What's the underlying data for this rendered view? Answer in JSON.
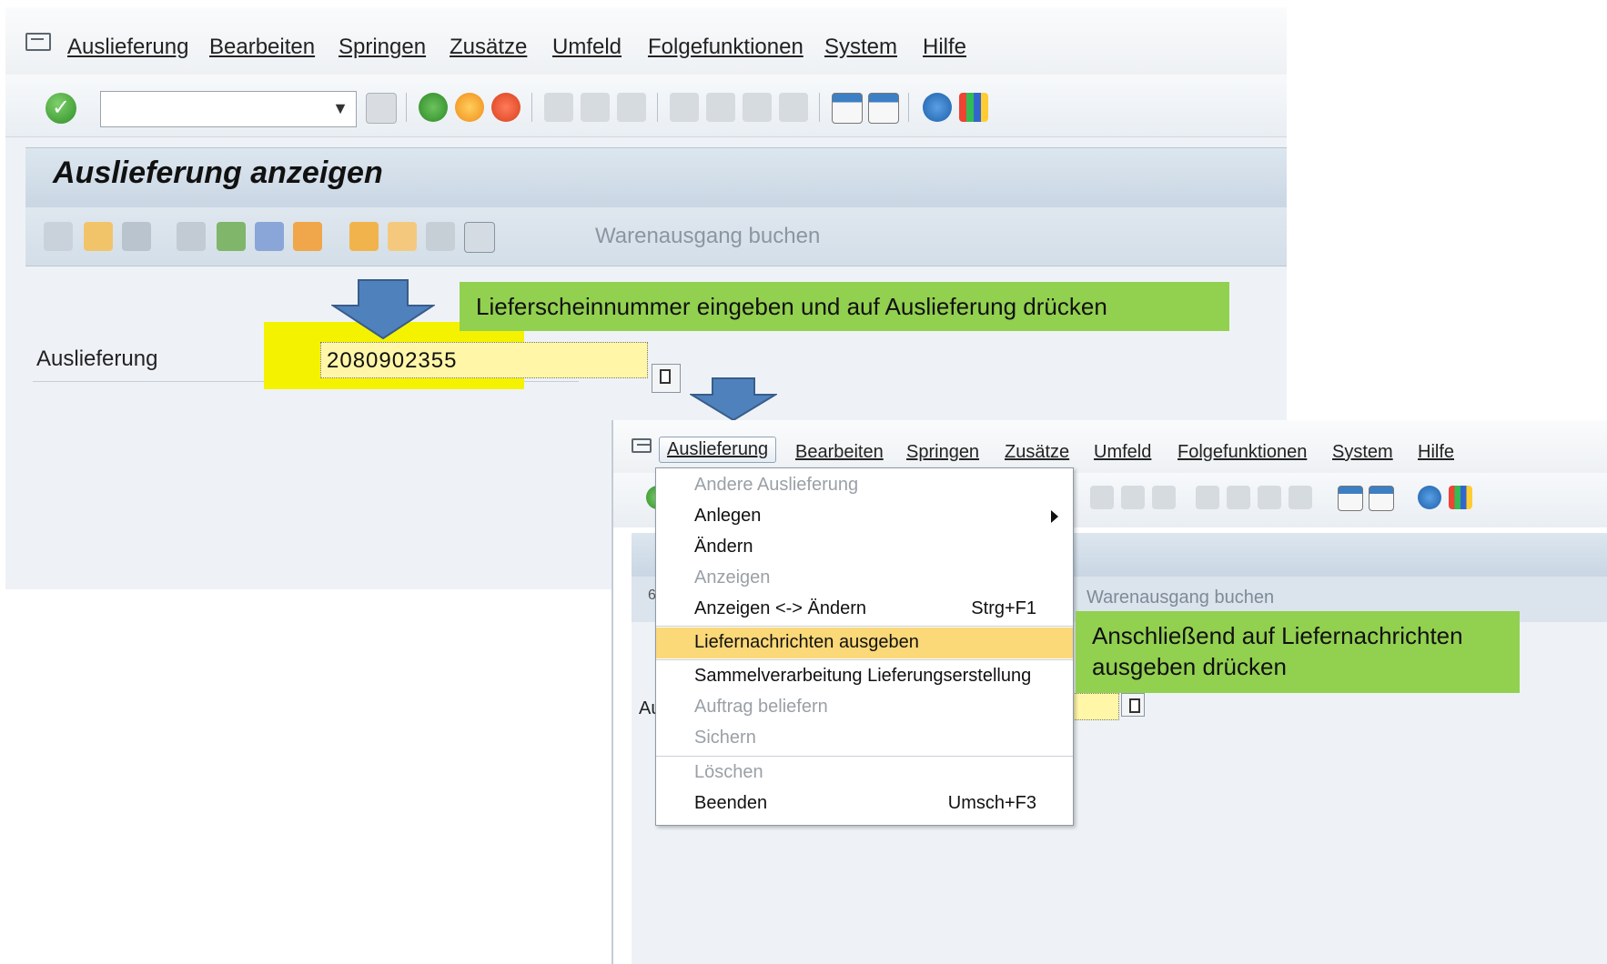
{
  "menubar": {
    "items": [
      "Auslieferung",
      "Bearbeiten",
      "Springen",
      "Zusätze",
      "Umfeld",
      "Folgefunktionen",
      "System",
      "Hilfe"
    ]
  },
  "toolbar": {
    "back_symbol": "«",
    "ok_symbol": "✓",
    "dropdown_symbol": "▼"
  },
  "screen1": {
    "title": "Auslieferung anzeigen",
    "app_toolbar_text": "Warenausgang buchen",
    "field_label": "Auslieferung",
    "field_value": "2080902355"
  },
  "callouts": {
    "first": "Lieferscheinnummer eingeben und auf Auslieferung drücken",
    "second": "Anschließend auf Liefernachrichten ausgeben drücken"
  },
  "screen2": {
    "active_menu": "Auslieferung",
    "app_toolbar_text": "Warenausgang buchen",
    "field_label_partial": "Au",
    "partial_char": "6",
    "dropdown": [
      {
        "label": "Andere Auslieferung",
        "shortcut": "",
        "disabled": true
      },
      {
        "label": "Anlegen",
        "shortcut": "",
        "disabled": false,
        "submenu": true
      },
      {
        "label": "Ändern",
        "shortcut": "",
        "disabled": false
      },
      {
        "label": "Anzeigen",
        "shortcut": "",
        "disabled": true
      },
      {
        "label": "Anzeigen <-> Ändern",
        "shortcut": "Strg+F1",
        "disabled": false
      },
      {
        "label": "Liefernachrichten ausgeben",
        "shortcut": "",
        "disabled": false,
        "highlighted": true
      },
      {
        "label": "Sammelverarbeitung Lieferungserstellung",
        "shortcut": "",
        "disabled": false
      },
      {
        "label": "Auftrag beliefern",
        "shortcut": "",
        "disabled": true
      },
      {
        "label": "Sichern",
        "shortcut": "",
        "disabled": true
      },
      {
        "label": "Löschen",
        "shortcut": "",
        "disabled": true
      },
      {
        "label": "Beenden",
        "shortcut": "Umsch+F3",
        "disabled": false
      }
    ]
  },
  "colors": {
    "callout_green": "#92d050",
    "highlight_yellow": "#f5f200",
    "arrow_blue": "#4f81bd",
    "menu_highlight": "#fbd878"
  }
}
